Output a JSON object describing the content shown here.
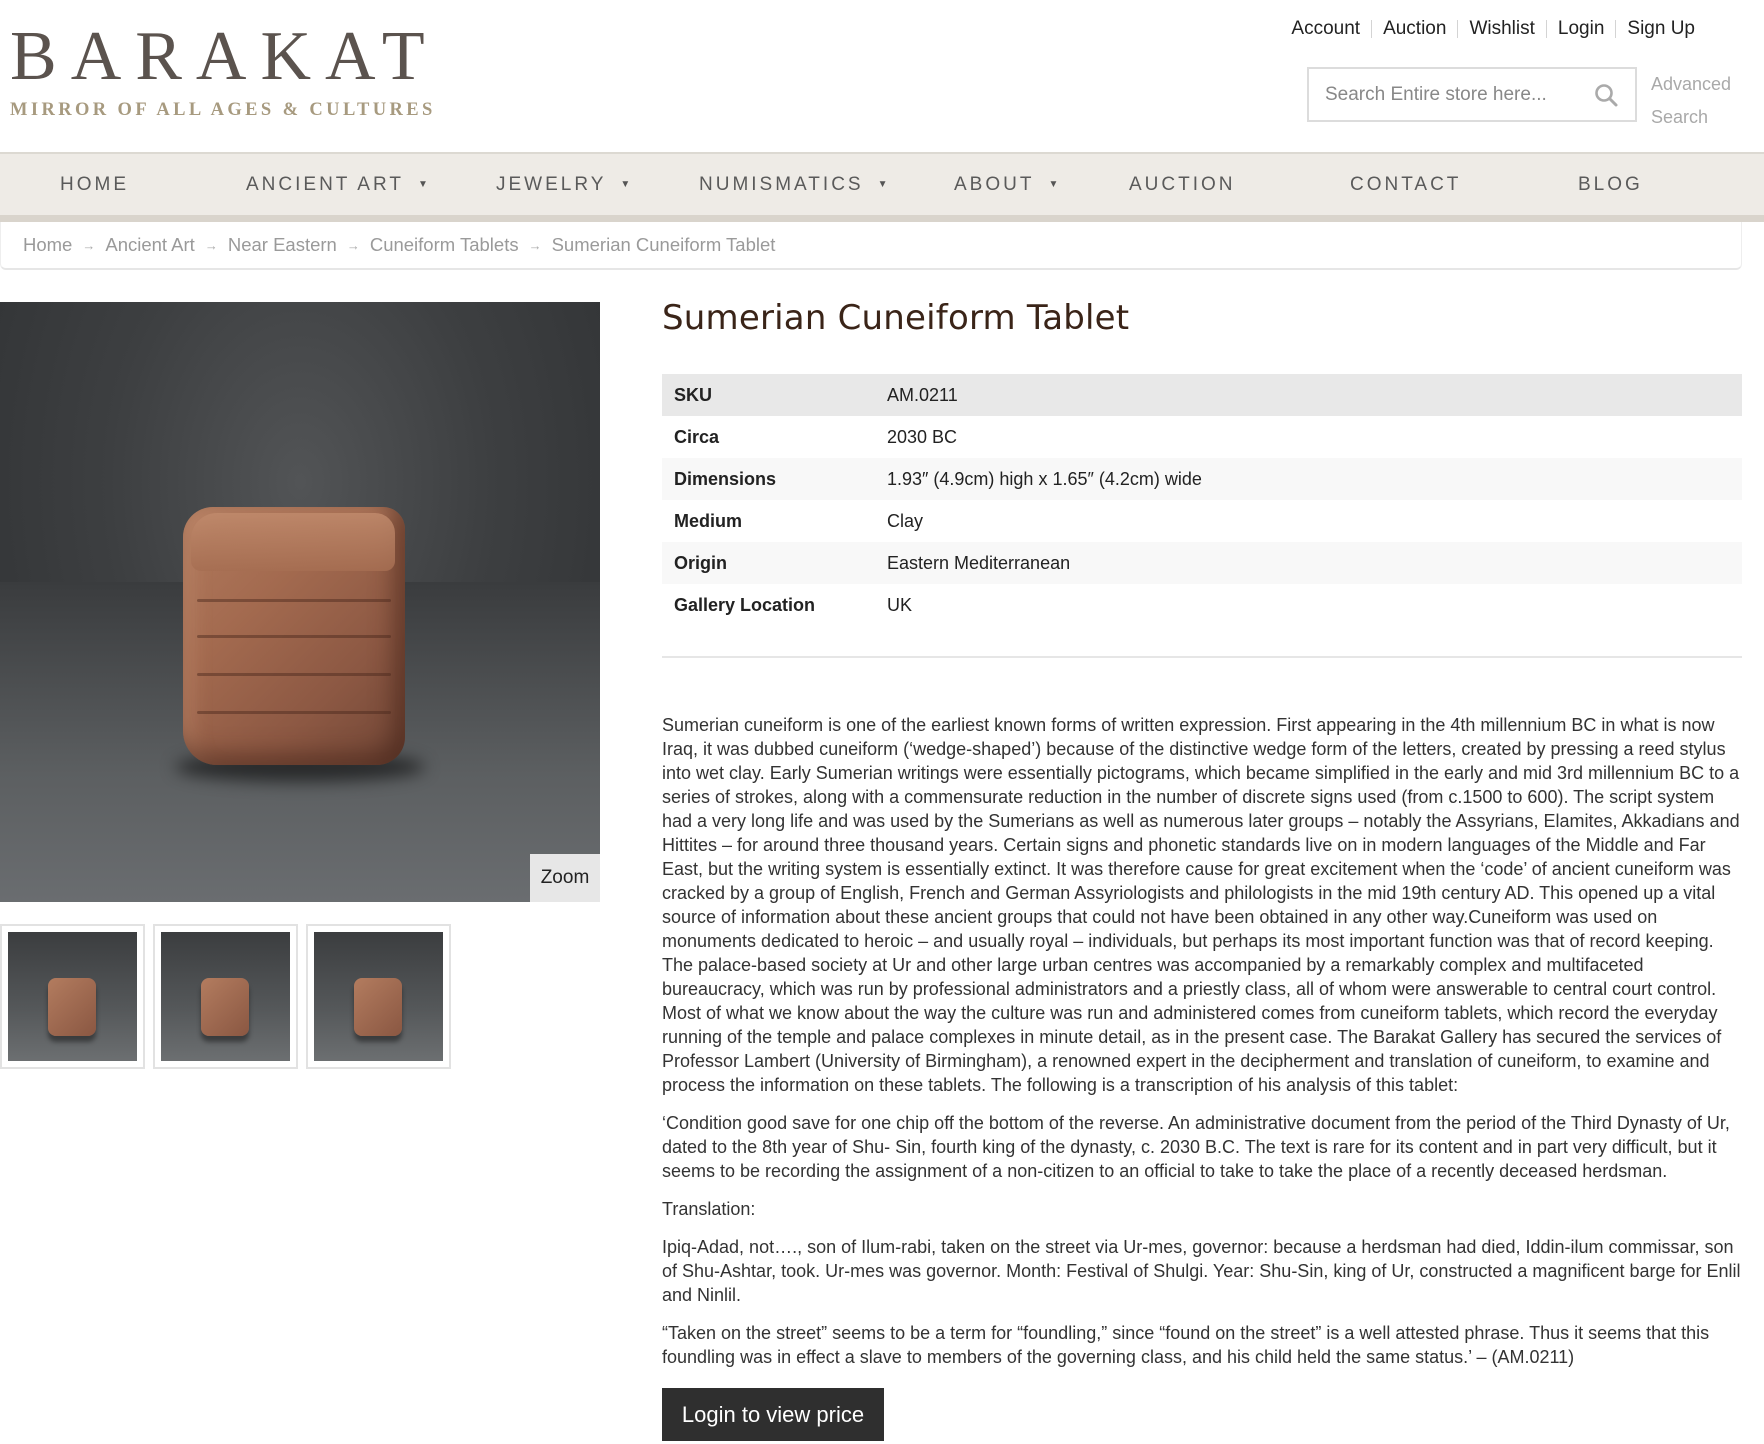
{
  "brand": {
    "name": "BARAKAT",
    "tagline": "MIRROR OF ALL AGES & CULTURES"
  },
  "top_links": [
    "Account",
    "Auction",
    "Wishlist",
    "Login",
    "Sign Up"
  ],
  "search": {
    "placeholder": "Search Entire store here...",
    "advanced_label": "Advanced Search",
    "icon": "search-icon"
  },
  "nav": [
    {
      "label": "HOME",
      "has_dropdown": false
    },
    {
      "label": "ANCIENT ART",
      "has_dropdown": true
    },
    {
      "label": "JEWELRY",
      "has_dropdown": true
    },
    {
      "label": "NUMISMATICS",
      "has_dropdown": true
    },
    {
      "label": "ABOUT",
      "has_dropdown": true
    },
    {
      "label": "AUCTION",
      "has_dropdown": false
    },
    {
      "label": "CONTACT",
      "has_dropdown": false
    },
    {
      "label": "BLOG",
      "has_dropdown": false
    }
  ],
  "breadcrumb": [
    "Home",
    "Ancient Art",
    "Near Eastern",
    "Cuneiform Tablets",
    "Sumerian Cuneiform Tablet"
  ],
  "gallery": {
    "zoom_label": "Zoom",
    "thumbnail_count": 3
  },
  "product": {
    "title": "Sumerian Cuneiform Tablet",
    "specs": [
      {
        "key": "SKU",
        "value": "AM.0211"
      },
      {
        "key": "Circa",
        "value": "2030 BC"
      },
      {
        "key": "Dimensions",
        "value": "1.93″ (4.9cm) high x 1.65″ (4.2cm) wide"
      },
      {
        "key": "Medium",
        "value": "Clay"
      },
      {
        "key": "Origin",
        "value": "Eastern Mediterranean"
      },
      {
        "key": "Gallery Location",
        "value": "UK"
      }
    ],
    "description": [
      "Sumerian cuneiform is one of the earliest known forms of written expression. First appearing in the 4th millennium BC in what is now Iraq, it was dubbed cuneiform (‘wedge-shaped’) because of the distinctive wedge form of the letters, created by pressing a reed stylus into wet clay. Early Sumerian writings were essentially pictograms, which became simplified in the early and mid 3rd millennium BC to a series of strokes, along with a commensurate reduction in the number of discrete signs used (from c.1500 to 600). The script system had a very long life and was used by the Sumerians as well as numerous later groups – notably the Assyrians, Elamites, Akkadians and Hittites – for around three thousand years. Certain signs and phonetic standards live on in modern languages of the Middle and Far East, but the writing system is essentially extinct. It was therefore cause for great excitement when the ‘code’ of ancient cuneiform was cracked by a group of English, French and German Assyriologists and philologists in the mid 19th century AD. This opened up a vital source of information about these ancient groups that could not have been obtained in any other way.Cuneiform was used on monuments dedicated to heroic – and usually royal – individuals, but perhaps its most important function was that of record keeping. The palace-based society at Ur and other large urban centres was accompanied by a remarkably complex and multifaceted bureaucracy, which was run by professional administrators and a priestly class, all of whom were answerable to central court control. Most of what we know about the way the culture was run and administered comes from cuneiform tablets, which record the everyday running of the temple and palace complexes in minute detail, as in the present case. The Barakat Gallery has secured the services of Professor Lambert (University of Birmingham), a renowned expert in the decipherment and translation of cuneiform, to examine and process the information on these tablets. The following is a transcription of his analysis of this tablet:",
      "‘Condition good save for one chip off the bottom of the reverse. An administrative document from the period of the Third Dynasty of Ur, dated to the 8th year of Shu- Sin, fourth king of the dynasty, c. 2030 B.C. The text is rare for its content and in part very difficult, but it seems to be recording the assignment of a non-citizen to an official to take to take the place of a recently deceased herdsman.",
      "Translation:",
      "Ipiq-Adad, not…., son of Ilum-rabi, taken on the street via Ur-mes, governor: because a herdsman had died, Iddin-ilum commissar, son of Shu-Ashtar, took. Ur-mes was governor. Month: Festival of Shulgi. Year: Shu-Sin, king of Ur, constructed a magnificent barge for Enlil and Ninlil.",
      "“Taken on the street” seems to be a term for “foundling,” since “found on the street” is a well attested phrase. Thus it seems that this foundling was in effect a slave to members of the governing class, and his child held the same status.’ – (AM.0211)"
    ],
    "cta_label": "Login to view price"
  }
}
